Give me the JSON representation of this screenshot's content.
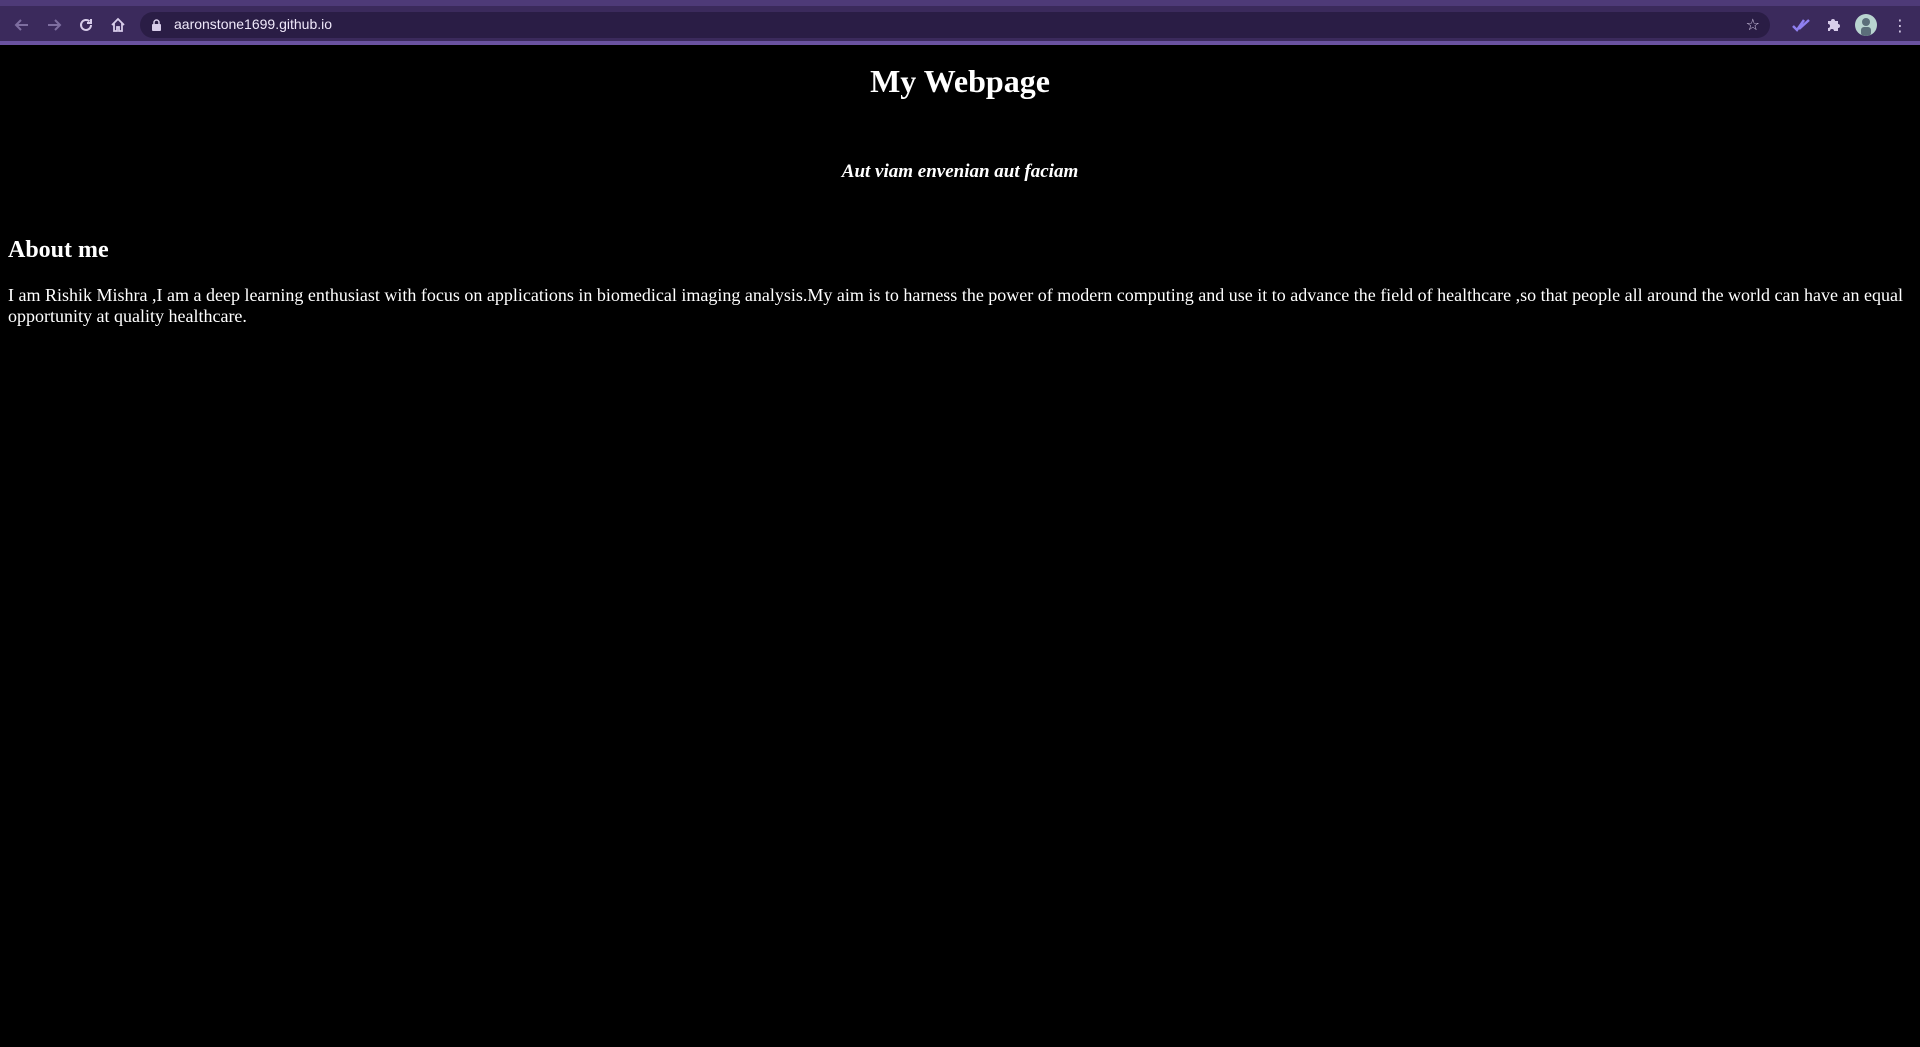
{
  "browser": {
    "url": "aaronstone1699.github.io",
    "back_icon": "arrow-left",
    "forward_icon": "arrow-right",
    "reload_icon": "reload",
    "home_icon": "home",
    "bookmark_icon": "star",
    "theme_color": "#3b2a5c"
  },
  "page": {
    "title": "My Webpage",
    "motto": "Aut viam envenian aut faciam",
    "about_heading": "About me",
    "about_text": "I am Rishik Mishra ,I am a deep learning enthusiast with focus on applications in biomedical imaging analysis.My aim is to harness the power of modern computing and use it to advance the field of healthcare ,so that people all around the world can have an equal opportunity at quality healthcare.",
    "background_color": "#000000",
    "text_color": "#ffffff"
  }
}
